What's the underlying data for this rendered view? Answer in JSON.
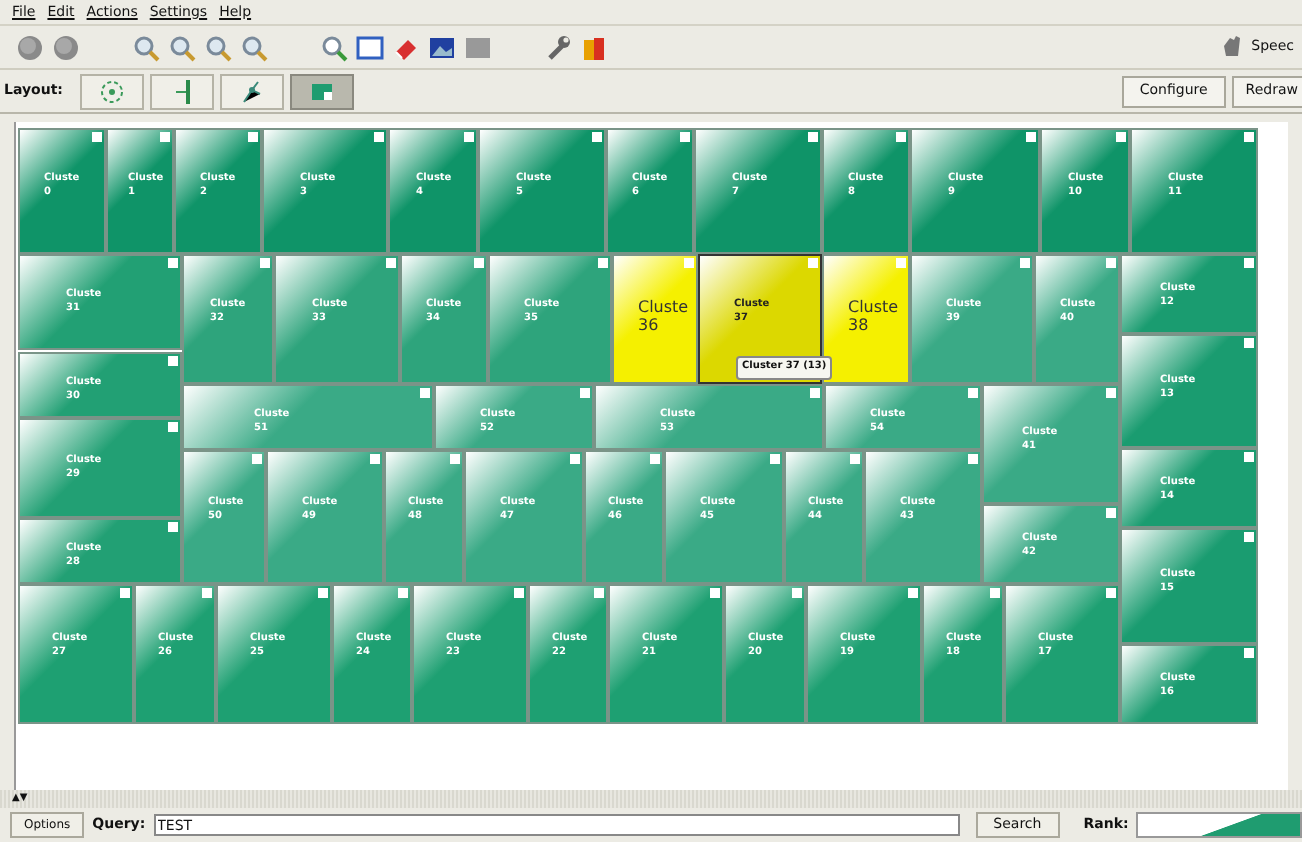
{
  "menu": [
    "File",
    "Edit",
    "Actions",
    "Settings",
    "Help"
  ],
  "toolbar": {
    "speech_label": "Speec"
  },
  "layout_bar": {
    "label": "Layout:",
    "layouts": [
      {
        "kind": "radial",
        "selected": false
      },
      {
        "kind": "split",
        "selected": false
      },
      {
        "kind": "force",
        "selected": false
      },
      {
        "kind": "treemap",
        "selected": true
      }
    ],
    "buttons": [
      "Configure",
      "Redraw"
    ]
  },
  "treemap": {
    "tiles": [
      {
        "label": "Cluste 0",
        "color": "#0f9468",
        "selected": false,
        "hovered": false
      },
      {
        "label": "Cluste 1",
        "color": "#0f9468",
        "selected": false,
        "hovered": false
      },
      {
        "label": "Cluste 2",
        "color": "#0f9468",
        "selected": false,
        "hovered": false
      },
      {
        "label": "Cluste 3",
        "color": "#0f9468",
        "selected": false,
        "hovered": false
      },
      {
        "label": "Cluste 4",
        "color": "#0f9468",
        "selected": false,
        "hovered": false
      },
      {
        "label": "Cluste 5",
        "color": "#0f9468",
        "selected": false,
        "hovered": false
      },
      {
        "label": "Cluste 6",
        "color": "#0f9468",
        "selected": false,
        "hovered": false
      },
      {
        "label": "Cluste 7",
        "color": "#0f9468",
        "selected": false,
        "hovered": false
      },
      {
        "label": "Cluste 8",
        "color": "#0f9468",
        "selected": false,
        "hovered": false
      },
      {
        "label": "Cluste 9",
        "color": "#0f9468",
        "selected": false,
        "hovered": false
      },
      {
        "label": "Cluste 10",
        "color": "#0f9468",
        "selected": false,
        "hovered": false
      },
      {
        "label": "Cluste 11",
        "color": "#0f9468",
        "selected": false,
        "hovered": false
      },
      {
        "label": "Cluste 31",
        "color": "#22a074",
        "selected": false,
        "hovered": false
      },
      {
        "label": "Cluste 32",
        "color": "#2ea47c",
        "selected": false,
        "hovered": false
      },
      {
        "label": "Cluste 33",
        "color": "#2ea47c",
        "selected": false,
        "hovered": false
      },
      {
        "label": "Cluste 34",
        "color": "#2ea47c",
        "selected": false,
        "hovered": false
      },
      {
        "label": "Cluste 35",
        "color": "#2ea47c",
        "selected": false,
        "hovered": false
      },
      {
        "label": "Cluste 36",
        "color": "#f5f000",
        "selected": true,
        "hovered": false
      },
      {
        "label": "Cluste 37",
        "color": "#dcd800",
        "selected": true,
        "hovered": true
      },
      {
        "label": "Cluste 38",
        "color": "#f5f000",
        "selected": true,
        "hovered": false
      },
      {
        "label": "Cluste 39",
        "color": "#3aaa86",
        "selected": false,
        "hovered": false
      },
      {
        "label": "Cluste 40",
        "color": "#3aaa86",
        "selected": false,
        "hovered": false
      },
      {
        "label": "Cluste 12",
        "color": "#1a9c70",
        "selected": false,
        "hovered": false
      },
      {
        "label": "Cluste 30",
        "color": "#22a074",
        "selected": false,
        "hovered": false
      },
      {
        "label": "Cluste 51",
        "color": "#3aaa86",
        "selected": false,
        "hovered": false
      },
      {
        "label": "Cluste 52",
        "color": "#3aaa86",
        "selected": false,
        "hovered": false
      },
      {
        "label": "Cluste 53",
        "color": "#3aaa86",
        "selected": false,
        "hovered": false
      },
      {
        "label": "Cluste 54",
        "color": "#3aaa86",
        "selected": false,
        "hovered": false
      },
      {
        "label": "Cluste 41",
        "color": "#3aaa86",
        "selected": false,
        "hovered": false
      },
      {
        "label": "Cluste 13",
        "color": "#1a9c70",
        "selected": false,
        "hovered": false
      },
      {
        "label": "Cluste 29",
        "color": "#22a074",
        "selected": false,
        "hovered": false
      },
      {
        "label": "Cluste 50",
        "color": "#3aaa86",
        "selected": false,
        "hovered": false
      },
      {
        "label": "Cluste 49",
        "color": "#3aaa86",
        "selected": false,
        "hovered": false
      },
      {
        "label": "Cluste 48",
        "color": "#3aaa86",
        "selected": false,
        "hovered": false
      },
      {
        "label": "Cluste 47",
        "color": "#3aaa86",
        "selected": false,
        "hovered": false
      },
      {
        "label": "Cluste 46",
        "color": "#3aaa86",
        "selected": false,
        "hovered": false
      },
      {
        "label": "Cluste 45",
        "color": "#3aaa86",
        "selected": false,
        "hovered": false
      },
      {
        "label": "Cluste 44",
        "color": "#3aaa86",
        "selected": false,
        "hovered": false
      },
      {
        "label": "Cluste 43",
        "color": "#3aaa86",
        "selected": false,
        "hovered": false
      },
      {
        "label": "Cluste 14",
        "color": "#1a9c70",
        "selected": false,
        "hovered": false
      },
      {
        "label": "Cluste 42",
        "color": "#3aaa86",
        "selected": false,
        "hovered": false
      },
      {
        "label": "Cluste 28",
        "color": "#22a074",
        "selected": false,
        "hovered": false
      },
      {
        "label": "Cluste 15",
        "color": "#1a9c70",
        "selected": false,
        "hovered": false
      },
      {
        "label": "Cluste 27",
        "color": "#1ea072",
        "selected": false,
        "hovered": false
      },
      {
        "label": "Cluste 26",
        "color": "#1ea072",
        "selected": false,
        "hovered": false
      },
      {
        "label": "Cluste 25",
        "color": "#1ea072",
        "selected": false,
        "hovered": false
      },
      {
        "label": "Cluste 24",
        "color": "#1ea072",
        "selected": false,
        "hovered": false
      },
      {
        "label": "Cluste 23",
        "color": "#1ea072",
        "selected": false,
        "hovered": false
      },
      {
        "label": "Cluste 22",
        "color": "#1ea072",
        "selected": false,
        "hovered": false
      },
      {
        "label": "Cluste 21",
        "color": "#1ea072",
        "selected": false,
        "hovered": false
      },
      {
        "label": "Cluste 20",
        "color": "#1ea072",
        "selected": false,
        "hovered": false
      },
      {
        "label": "Cluste 19",
        "color": "#1ea072",
        "selected": false,
        "hovered": false
      },
      {
        "label": "Cluste 18",
        "color": "#1ea072",
        "selected": false,
        "hovered": false
      },
      {
        "label": "Cluste 17",
        "color": "#1ea072",
        "selected": false,
        "hovered": false
      },
      {
        "label": "Cluste 16",
        "color": "#1a9c70",
        "selected": false,
        "hovered": false
      }
    ],
    "tooltip": "Cluster 37 (13)"
  },
  "splitter": {
    "arrows": "▲▼"
  },
  "query_bar": {
    "options_button": "Options",
    "query_label": "Query:",
    "query_value": "TEST",
    "search_button": "Search",
    "rank_label": "Rank:"
  }
}
